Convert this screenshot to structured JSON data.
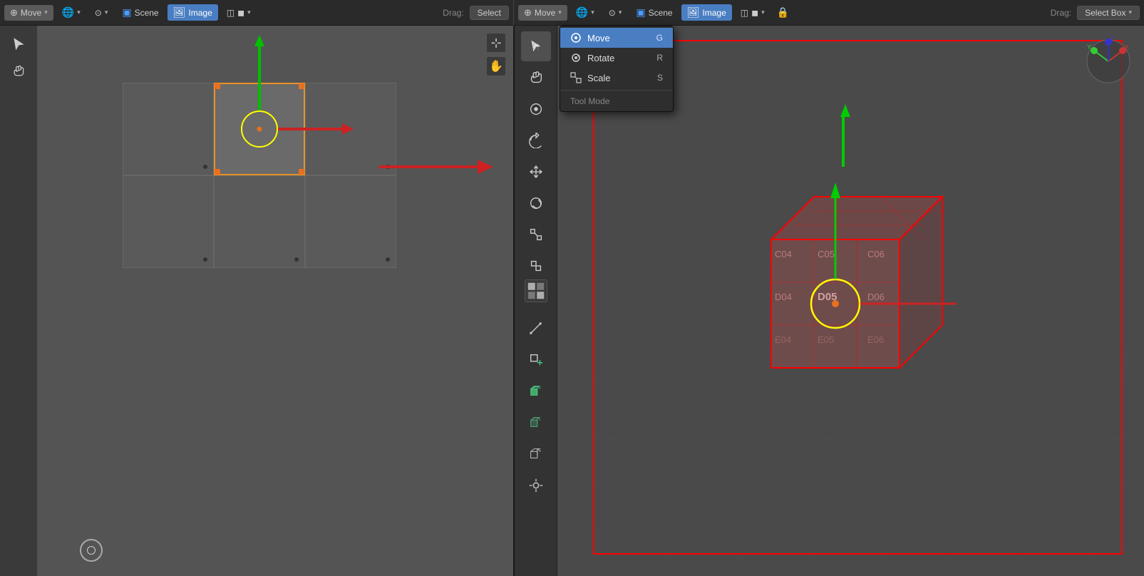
{
  "header": {
    "left": {
      "tool_label": "Move",
      "drag_label": "Drag:",
      "select_label": "Select",
      "scene_label": "Scene",
      "image_label": "Image"
    },
    "right": {
      "tool_label": "Move",
      "drag_label": "Drag:",
      "select_box_label": "Select Box",
      "scene_label": "Scene",
      "image_label": "Image"
    }
  },
  "dropdown": {
    "items": [
      {
        "label": "Move",
        "shortcut": "G",
        "highlighted": true,
        "icon": "move-icon"
      },
      {
        "label": "Rotate",
        "shortcut": "R",
        "highlighted": false,
        "icon": "rotate-icon"
      },
      {
        "label": "Scale",
        "shortcut": "S",
        "highlighted": false,
        "icon": "scale-icon"
      }
    ],
    "section": "Tool Mode"
  },
  "toolbar_middle": {
    "tools": [
      {
        "name": "cursor-tool",
        "icon": "cursor"
      },
      {
        "name": "move-tool",
        "icon": "move"
      },
      {
        "name": "pan-tool",
        "icon": "hand"
      },
      {
        "name": "transform-tool",
        "icon": "transform"
      },
      {
        "name": "rotate-view-tool",
        "icon": "rotate"
      },
      {
        "name": "translate-tool",
        "icon": "translate4way"
      },
      {
        "name": "rotate-tool",
        "icon": "rotate3d"
      },
      {
        "name": "scale-tool",
        "icon": "scale3d"
      },
      {
        "name": "transform3d-tool",
        "icon": "transform3d"
      },
      {
        "name": "annotate-tool",
        "icon": "annotate"
      },
      {
        "name": "measure-tool",
        "icon": "measure"
      },
      {
        "name": "add-cube-tool",
        "icon": "addcube"
      },
      {
        "name": "green-cube-tool",
        "icon": "greencube"
      },
      {
        "name": "dark-cube-tool",
        "icon": "darkcube"
      },
      {
        "name": "cube-wire-tool",
        "icon": "cubewire"
      }
    ]
  },
  "grid": {
    "selected_cell": [
      1,
      1
    ],
    "grid_labels": [
      "C04",
      "C05",
      "C06",
      "D04",
      "D05",
      "D06",
      "E04",
      "E05",
      "E06"
    ]
  },
  "icons": {
    "move": "⊕",
    "rotate": "↺",
    "scale": "⇲",
    "cursor": "↖",
    "hand": "✋",
    "plus": "+",
    "minus": "−"
  }
}
